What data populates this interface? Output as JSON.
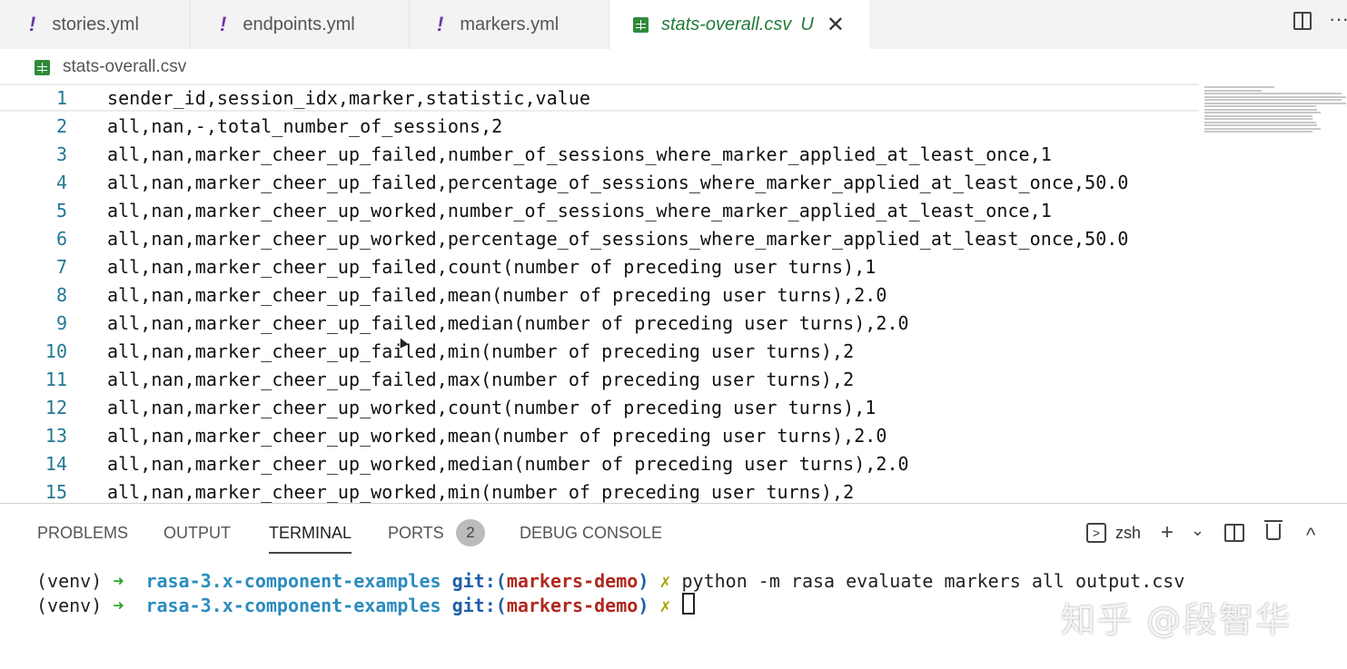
{
  "tabs": [
    {
      "icon": "!",
      "label": "stories.yml"
    },
    {
      "icon": "!",
      "label": "endpoints.yml"
    },
    {
      "icon": "!",
      "label": "markers.yml"
    },
    {
      "label": "stats-overall.csv",
      "status": "U",
      "close": "✕"
    }
  ],
  "breadcrumb": "stats-overall.csv",
  "editor": {
    "lines": [
      {
        "n": "1",
        "text": "sender_id,session_idx,marker,statistic,value"
      },
      {
        "n": "2",
        "text": "all,nan,-,total_number_of_sessions,2"
      },
      {
        "n": "3",
        "text": "all,nan,marker_cheer_up_failed,number_of_sessions_where_marker_applied_at_least_once,1"
      },
      {
        "n": "4",
        "text": "all,nan,marker_cheer_up_failed,percentage_of_sessions_where_marker_applied_at_least_once,50.0"
      },
      {
        "n": "5",
        "text": "all,nan,marker_cheer_up_worked,number_of_sessions_where_marker_applied_at_least_once,1"
      },
      {
        "n": "6",
        "text": "all,nan,marker_cheer_up_worked,percentage_of_sessions_where_marker_applied_at_least_once,50.0"
      },
      {
        "n": "7",
        "text": "all,nan,marker_cheer_up_failed,count(number of preceding user turns),1"
      },
      {
        "n": "8",
        "text": "all,nan,marker_cheer_up_failed,mean(number of preceding user turns),2.0"
      },
      {
        "n": "9",
        "text": "all,nan,marker_cheer_up_failed,median(number of preceding user turns),2.0"
      },
      {
        "n": "10",
        "text": "all,nan,marker_cheer_up_failed,min(number of preceding user turns),2"
      },
      {
        "n": "11",
        "text": "all,nan,marker_cheer_up_failed,max(number of preceding user turns),2"
      },
      {
        "n": "12",
        "text": "all,nan,marker_cheer_up_worked,count(number of preceding user turns),1"
      },
      {
        "n": "13",
        "text": "all,nan,marker_cheer_up_worked,mean(number of preceding user turns),2.0"
      },
      {
        "n": "14",
        "text": "all,nan,marker_cheer_up_worked,median(number of preceding user turns),2.0"
      },
      {
        "n": "15",
        "text": "all,nan,marker_cheer_up_worked,min(number of preceding user turns),2"
      }
    ]
  },
  "panel": {
    "tabs": {
      "problems": "PROBLEMS",
      "output": "OUTPUT",
      "terminal": "TERMINAL",
      "ports": "PORTS",
      "debug": "DEBUG CONSOLE"
    },
    "ports_badge": "2",
    "shell": "zsh",
    "shell_icon": ">",
    "add_icon": "+",
    "dropdown_icon": "⌄",
    "collapse_icon": "^"
  },
  "terminal": {
    "lines": [
      {
        "venv": "(venv)",
        "arrow": "➜",
        "dir": "rasa-3.x-component-examples",
        "git": "git:(",
        "branch": "markers-demo",
        "gitclose": ")",
        "x": "✗",
        "cmd": "python -m rasa evaluate markers all output.csv"
      },
      {
        "venv": "(venv)",
        "arrow": "➜",
        "dir": "rasa-3.x-component-examples",
        "git": "git:(",
        "branch": "markers-demo",
        "gitclose": ")",
        "x": "✗",
        "cmd": ""
      }
    ]
  },
  "watermark": "知乎 @段智华"
}
